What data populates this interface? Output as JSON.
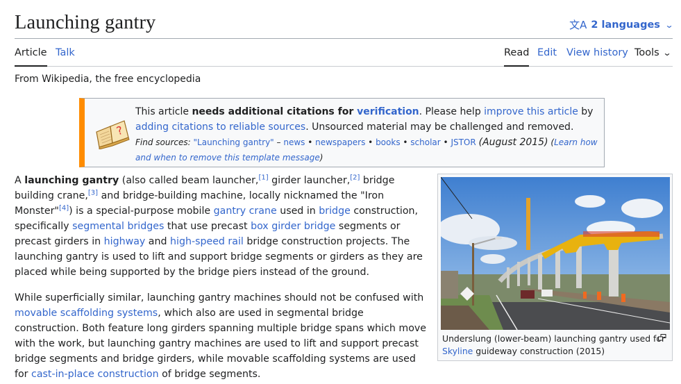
{
  "header": {
    "title": "Launching gantry",
    "languages_label": "2 languages",
    "languages_icon": "translate-icon"
  },
  "tabs": {
    "left": [
      {
        "label": "Article",
        "active": true
      },
      {
        "label": "Talk",
        "active": false
      }
    ],
    "right": [
      {
        "label": "Read",
        "active": true
      },
      {
        "label": "Edit",
        "active": false
      },
      {
        "label": "View history",
        "active": false
      },
      {
        "label": "Tools",
        "active": false,
        "dropdown": true
      }
    ]
  },
  "tagline": "From Wikipedia, the free encyclopedia",
  "ambox": {
    "icon": "open-book-question-icon",
    "accent_color": "#ff8c00",
    "t1": "This article ",
    "bold": "needs additional citations for ",
    "bold_link": "verification",
    "t2": ". Please help ",
    "link_improve": "improve this article",
    "t3": " by ",
    "link_adding": "adding citations to reliable sources",
    "t4": ". Unsourced material may be challenged and removed.",
    "find_sources_label": "Find sources:",
    "find_query": "\"Launching gantry\"",
    "dash": " – ",
    "sources": [
      "news",
      "newspapers",
      "books",
      "scholar",
      "JSTOR"
    ],
    "separator": " • ",
    "date": "(August 2015)",
    "learn_open": "(",
    "learn_link": "Learn how and when to remove this template message",
    "learn_close": ")"
  },
  "paragraph1": {
    "t0": "A ",
    "bold": "launching gantry",
    "t1": " (also called beam launcher,",
    "ref1": "[1]",
    "t2": " girder launcher,",
    "ref2": "[2]",
    "t3": " bridge building crane,",
    "ref3": "[3]",
    "t4": " and bridge-building machine, locally nicknamed the \"Iron Monster\"",
    "ref4": "[4]",
    "t5": ") is a special-purpose mobile ",
    "link_gantry_crane": "gantry crane",
    "t6": " used in ",
    "link_bridge": "bridge",
    "t7": " construction, specifically ",
    "link_segmental": "segmental bridges",
    "t8": " that use precast ",
    "link_box_girder": "box girder bridge",
    "t9": " segments or precast girders in ",
    "link_highway": "highway",
    "t10": " and ",
    "link_hsr": "high-speed rail",
    "t11": " bridge construction projects. The launching gantry is used to lift and support bridge segments or girders as they are placed while being supported by the bridge piers instead of the ground."
  },
  "paragraph2": {
    "t0": "While superficially similar, launching gantry machines should not be confused with ",
    "link_mss": "movable scaffolding systems",
    "t1": ", which also are used in segmental bridge construction. Both feature long girders spanning multiple bridge spans which move with the work, but launching gantry machines are used to lift and support precast bridge segments and bridge girders, while movable scaffolding systems are used for ",
    "link_cip": "cast-in-place construction",
    "t2": " of bridge segments."
  },
  "figure": {
    "image_alt": "Launching gantry over road with elevated guideway",
    "caption_t0": "Underslung (lower-beam) launching gantry used for ",
    "caption_link": "Skyline",
    "caption_t1": " guideway construction (2015)",
    "enlarge_icon": "enlarge-icon"
  }
}
